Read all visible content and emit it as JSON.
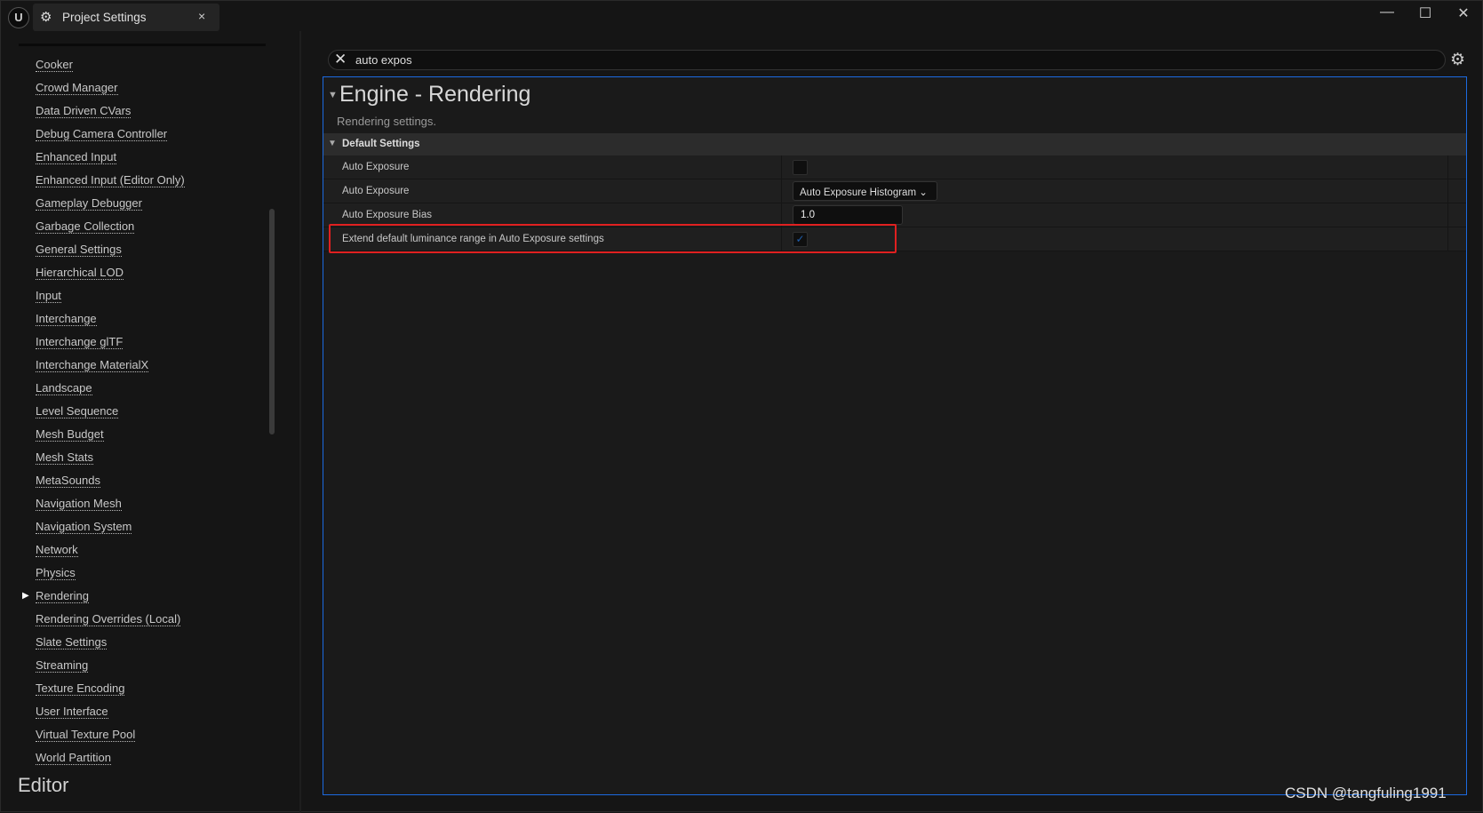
{
  "window": {
    "tab_title": "Project Settings",
    "tab_icon": "project-settings-icon",
    "close_tab": "×",
    "minimize": "—",
    "maximize": "☐",
    "close": "✕"
  },
  "sidebar": {
    "items": [
      "Cooker",
      "Crowd Manager",
      "Data Driven CVars",
      "Debug Camera Controller",
      "Enhanced Input",
      "Enhanced Input (Editor Only)",
      "Gameplay Debugger",
      "Garbage Collection",
      "General Settings",
      "Hierarchical LOD",
      "Input",
      "Interchange",
      "Interchange glTF",
      "Interchange MaterialX",
      "Landscape",
      "Level Sequence",
      "Mesh Budget",
      "Mesh Stats",
      "MetaSounds",
      "Navigation Mesh",
      "Navigation System",
      "Network",
      "Physics",
      "Rendering",
      "Rendering Overrides (Local)",
      "Slate Settings",
      "Streaming",
      "Texture Encoding",
      "User Interface",
      "Virtual Texture Pool",
      "World Partition"
    ],
    "selected": "Rendering",
    "section_heading": "Editor"
  },
  "search": {
    "value": "auto expos"
  },
  "panel": {
    "title": "Engine - Rendering",
    "subtitle": "Rendering settings.",
    "category": "Default Settings",
    "rows": [
      {
        "label": "Auto Exposure",
        "type": "checkbox",
        "checked": false
      },
      {
        "label": "Auto Exposure",
        "type": "dropdown",
        "value": "Auto Exposure Histogram"
      },
      {
        "label": "Auto Exposure Bias",
        "type": "number",
        "value": "1.0"
      },
      {
        "label": "Extend default luminance range in Auto Exposure settings",
        "type": "checkbox",
        "checked": true,
        "highlighted": true
      }
    ]
  },
  "watermark": "CSDN @tangfuling1991",
  "colors": {
    "accent": "#1c6ae0",
    "highlight": "#e02020",
    "check": "#1f5fb0"
  }
}
